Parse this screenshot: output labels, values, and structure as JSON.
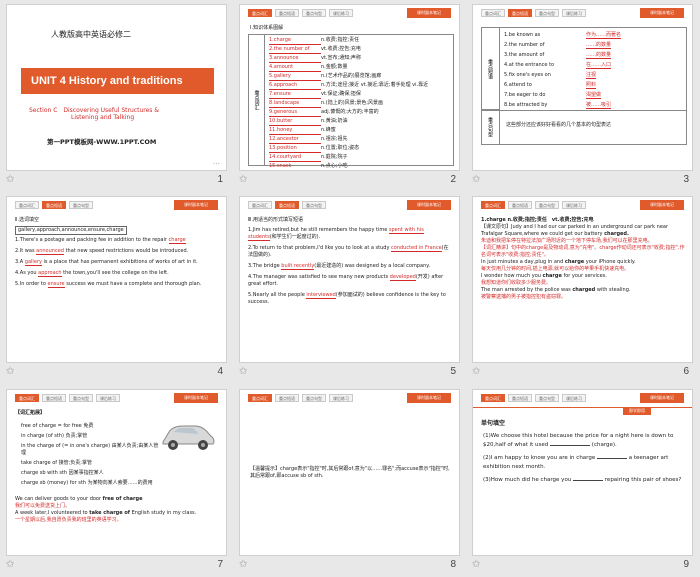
{
  "thumbs": [
    {
      "num": "1",
      "title": "人教版高中英语必修二",
      "unit": "UNIT 4  History and traditions",
      "section": "Section C　Discovering Useful Structures &",
      "section2": "Listening and Talking",
      "site": "第一PPT模板网-WWW.1PPT.COM"
    },
    {
      "num": "2",
      "ribbon": "课时副本笔记",
      "heading": "Ⅰ.知识体系图解",
      "side": "重点词汇",
      "rows": [
        "1.charge",
        "2.the number of",
        "3.announce",
        "4.amount",
        "5.gallery",
        "6.approach",
        "7.ensure",
        "8.landscape",
        "9.generous",
        "10.butter",
        "11.honey",
        "12.ancestor",
        "13.position",
        "14.courtyard",
        "15.snack",
        "16.eager"
      ],
      "defs": [
        "n.收费;指控;责任",
        "vt.收费;控告;充电",
        "vt.宣布;通知;声称",
        "n.金额;数量",
        "n.(艺术作品的)展览馆;画廊",
        "n.方法;途径;接近 vt.接近;靠近;着手处理 vi.靠近",
        "vt.保证;确保;担保",
        "n.(陆上的)风景;景色;风景画",
        "adj.慷慨的;大方的;丰富的",
        "n.黄油;奶油",
        "n.蜂蜜",
        "n.祖宗;祖先",
        "n.位置;职位;姿态",
        "n.庭院;院子",
        "n.点心;小吃",
        "adj.渴望的;热切的"
      ]
    },
    {
      "num": "3",
      "ribbon": "课时副本笔记",
      "side1": "重点短语",
      "rows": [
        "1.be known as",
        "2.the number of",
        "3.the amount of",
        "4.at the entrance to",
        "5.fix one's eyes on",
        "6.attend to",
        "7.be eager to do",
        "8.be attracted by"
      ],
      "fills": [
        "作为……而著名",
        "……的数量",
        "……的数量",
        "在……入口",
        "注视",
        "照料",
        "渴望做",
        "被……吸引"
      ],
      "side2": "重点句型",
      "note": "这些部分还应该好好看看的几个基本的句型表达"
    },
    {
      "num": "4",
      "ribbon": "课时副本笔记",
      "heading": "Ⅱ.选词填空",
      "words": "gallery,approach,announce,ensure,charge",
      "s1a": "1.There's a postage and packing fee in addition to the repair",
      "s1b": "charge",
      "s2a": "2.It was",
      "s2b": "announced",
      "s2c": "that new speed restrictions would be introduced.",
      "s3a": "3.A",
      "s3b": "gallery",
      "s3c": "is a place that has permanent exhibitions of works of art in it.",
      "s4a": "4.As you",
      "s4b": "approach",
      "s4c": "the town,you'll see the college on the left.",
      "s5a": "5.In order to",
      "s5b": "ensure",
      "s5c": "success we must have a complete and thorough plan."
    },
    {
      "num": "5",
      "ribbon": "课时副本笔记",
      "heading": "Ⅲ.用适当的形式填写短语",
      "s1": "1.Jim has retired,but he still remembers the happy time",
      "s1b": "spent with his students",
      "s1c": "(和学生们一起度过的).",
      "s2": "2.To return to that problem,I'd like you to look at a study",
      "s2b": "conducted in France",
      "s2c": "(在法国做的).",
      "s3": "3.The bridge",
      "s3b": "built recently",
      "s3c": "(最近建造的) was designed by a local company.",
      "s4": "4.The manager was satisfied to see many new products",
      "s4b": "developed",
      "s4c": "(开发) after great effort.",
      "s5": "5.Nearly all the people",
      "s5b": "interviewed",
      "s5c": "(参加面试的) believe confidence is the key to success."
    },
    {
      "num": "6",
      "ribbon": "课时副本笔记",
      "l1": "1.charge n.收费;指控;责任　vt.收费;控告;充电",
      "l2": "【课文原句】Judy and I had our car parked in an underground car park near Trafalgar Square,where we could get our battery",
      "l2b": "charged.",
      "l3": "朱迪和我把车停在特拉法加广场附近的一个地下停车场,我们可以在那里充电。",
      "l4": "【词汇精讲】句中的charge是及物动词,意为\"充电\"。charge作动词还可表示\"收费;指控\",作名词可表示\"收费;指控;责任\"。",
      "l5": "In just minutes a day,plug in and",
      "l5b": "charge",
      "l5c": "your iPhone quickly.",
      "l6": "每天仅用几分钟的时间,插上电源,就可以给你的苹果手机快速充电。",
      "l7": "I wonder how much you",
      "l7b": "charge",
      "l7c": "for your services.",
      "l8": "我想知道你们收取多少服务费。",
      "l9": "The man arrested by the police was",
      "l9b": "charged",
      "l9c": "with stealing.",
      "l10": "被警察逮捕的男子被指控犯有盗窃罪。"
    },
    {
      "num": "7",
      "ribbon": "课时副本笔记",
      "title": "【词汇拓展】",
      "items": [
        "free of charge = for free 免费",
        "in charge (of sth) 负责;掌管",
        "in the charge of (= in one's charge) 由某人负责;由某人管理",
        "take charge of 接管;负责;掌管",
        "charge sb with sth 因某事指控某人",
        "charge sb (money) for sth 为某物向某人索要……的费用"
      ],
      "e1": "We can deliver goods to your door",
      "e1b": "free of charge",
      "e2": "我们可以免费送货上门。",
      "e3": "A week later,I volunteered to",
      "e3b": "take charge of",
      "e3c": "English study in my class.",
      "e4": "一个星期以后,我自愿负责我的班里的英语学习。"
    },
    {
      "num": "8",
      "ribbon": "课时副本笔记",
      "tip": "【温馨提示】charge表示\"指控\"时,其后常跟of,意为\"以……罪名\";而accuse表示\"指控\"时,其后常跟of,即accuse sb of sth."
    },
    {
      "num": "9",
      "ribbon": "课时副本笔记",
      "banner": "即学即用",
      "heading": "单句填空",
      "q1": "(1)We choose this hotel because the price for a night here is down to $20,half of what it used",
      "q1b": "(charge).",
      "q2": "(2)I am happy to know you are in charge",
      "q2b": "a teenager art exhibition next month.",
      "q3": "(3)How much did he charge you",
      "q3b": "repairing this pair of shoes?"
    }
  ],
  "tab_labels": [
    "重点词汇",
    "重点短语",
    "重点句型",
    "课后练习"
  ],
  "star_glyph": "✩"
}
